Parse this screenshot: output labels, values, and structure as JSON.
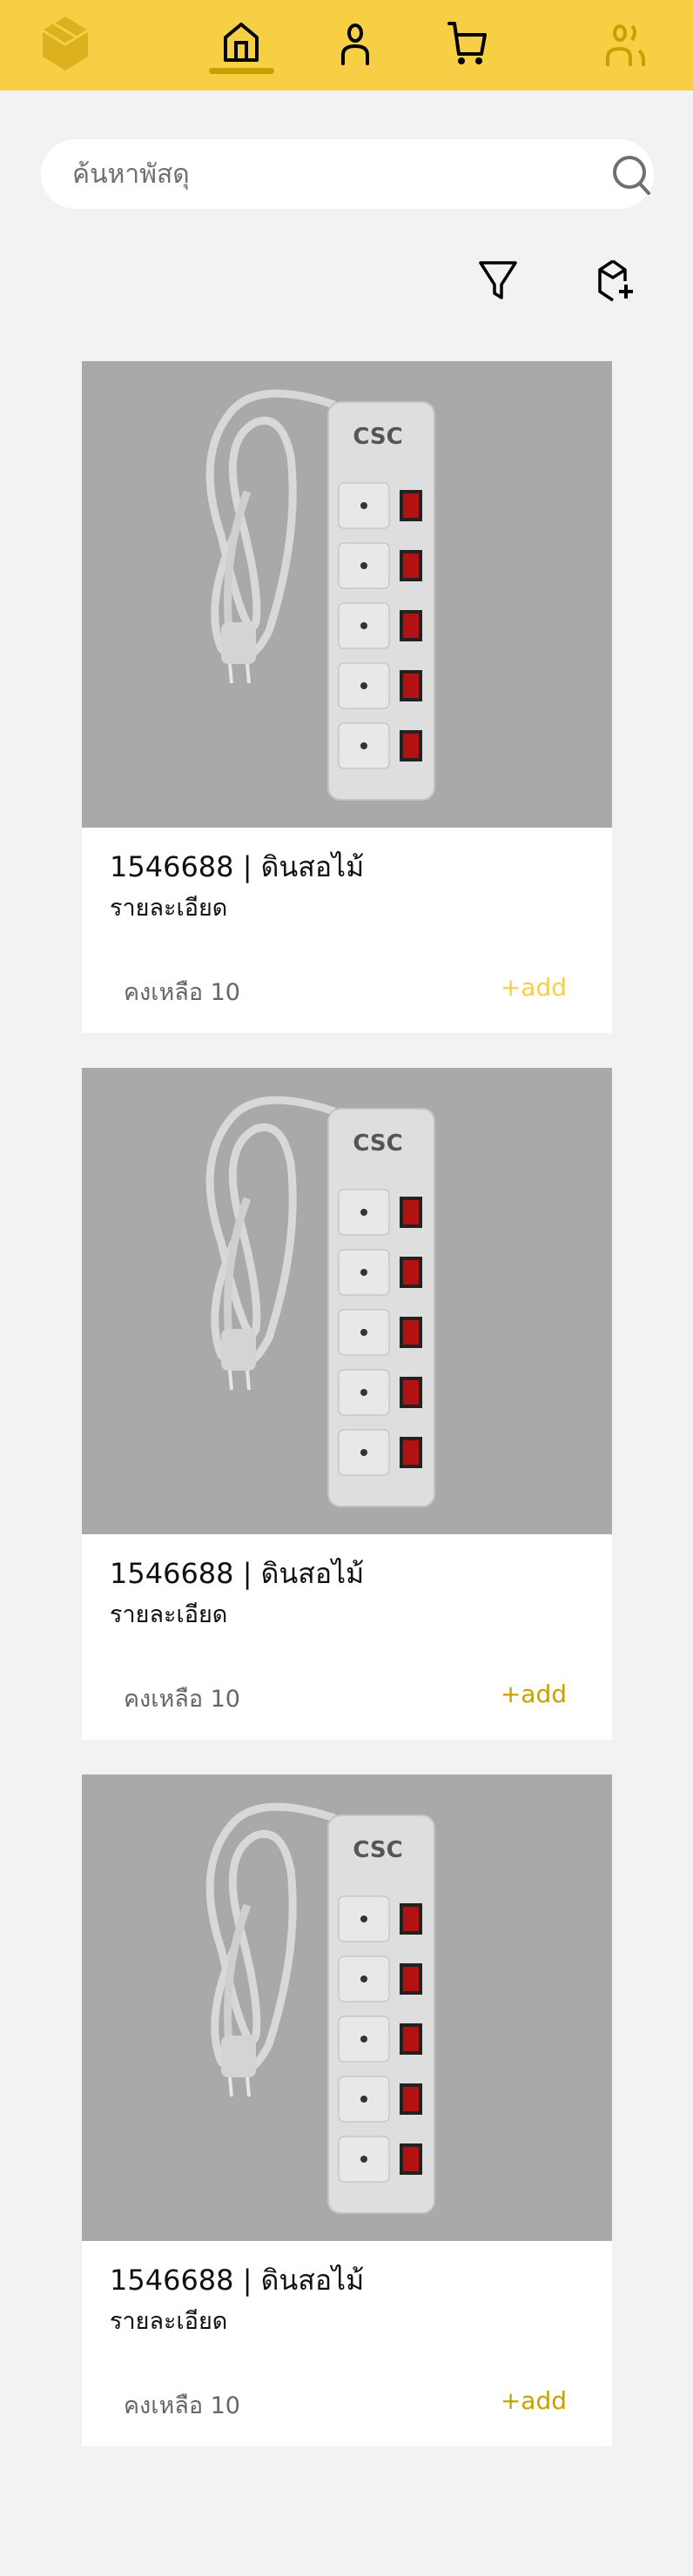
{
  "header": {
    "nav": [
      "logo-box",
      "home",
      "profile",
      "cart",
      "users"
    ],
    "colors": {
      "bar": "#f7cf45",
      "active": "#c9a000"
    }
  },
  "search": {
    "placeholder": "ค้นหาพัสดุ",
    "value": ""
  },
  "toolbar": {
    "icons": [
      "filter-icon",
      "box-plus-icon"
    ]
  },
  "products": [
    {
      "title": "1546688 | ดินสอไม้",
      "description": "รายละเอียด",
      "stock": "คงเหลือ 10",
      "add_label": "+add",
      "add_color": "#f7cf45",
      "brand_logo": "CSC"
    },
    {
      "title": "1546688 | ดินสอไม้",
      "description": "รายละเอียด",
      "stock": "คงเหลือ 10",
      "add_label": "+add",
      "add_color": "#c9a000",
      "brand_logo": "CSC"
    },
    {
      "title": "1546688 | ดินสอไม้",
      "description": "รายละเอียด",
      "stock": "คงเหลือ 10",
      "add_label": "+add",
      "add_color": "#c9a000",
      "brand_logo": "CSC"
    }
  ]
}
